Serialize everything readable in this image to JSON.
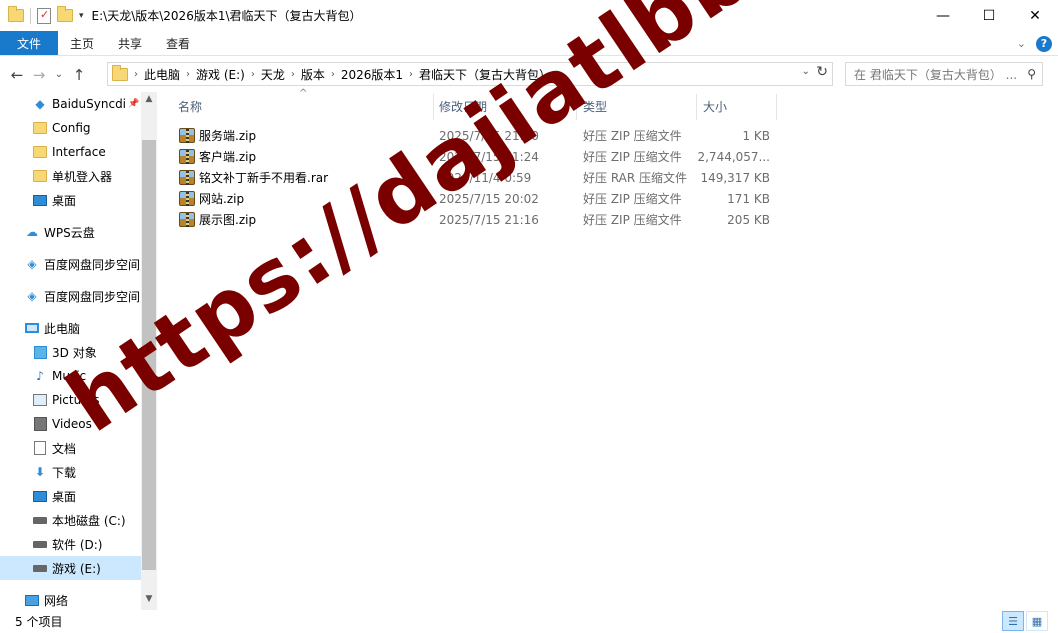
{
  "window": {
    "title": "E:\\天龙\\版本\\2026版本1\\君临天下（复古大背包）",
    "controls": {
      "minimize": "—",
      "maximize": "☐",
      "close": "✕"
    }
  },
  "ribbon": {
    "tabs": [
      "文件",
      "主页",
      "共享",
      "查看"
    ]
  },
  "nav": {
    "back": "←",
    "forward": "→",
    "recent": "⌄",
    "up": "↑",
    "breadcrumbs": [
      "此电脑",
      "游戏 (E:)",
      "天龙",
      "版本",
      "2026版本1",
      "君临天下（复古大背包）"
    ],
    "search_placeholder": "在 君临天下（复古大背包） ..."
  },
  "sidebar": {
    "items": [
      {
        "label": "BaiduSyncdi",
        "icon": "baidu-sync-icon",
        "pinned": "📌"
      },
      {
        "label": "Config",
        "icon": "folder-icon"
      },
      {
        "label": "Interface",
        "icon": "folder-icon"
      },
      {
        "label": "单机登入器",
        "icon": "folder-icon"
      },
      {
        "label": "桌面",
        "icon": "desktop-icon"
      },
      {
        "label": "WPS云盘",
        "icon": "cloud-icon"
      },
      {
        "label": "百度网盘同步空间",
        "icon": "baidu-icon"
      },
      {
        "label": "百度网盘同步空间",
        "icon": "baidu-icon"
      },
      {
        "label": "此电脑",
        "icon": "computer-icon"
      },
      {
        "label": "3D 对象",
        "icon": "3d-objects-icon"
      },
      {
        "label": "Music",
        "icon": "music-icon"
      },
      {
        "label": "Pictures",
        "icon": "pictures-icon"
      },
      {
        "label": "Videos",
        "icon": "videos-icon"
      },
      {
        "label": "文档",
        "icon": "documents-icon"
      },
      {
        "label": "下载",
        "icon": "downloads-icon"
      },
      {
        "label": "桌面",
        "icon": "desktop-icon"
      },
      {
        "label": "本地磁盘 (C:)",
        "icon": "drive-icon"
      },
      {
        "label": "软件 (D:)",
        "icon": "drive-icon"
      },
      {
        "label": "游戏 (E:)",
        "icon": "drive-icon"
      },
      {
        "label": "网络",
        "icon": "network-icon"
      }
    ]
  },
  "columns": {
    "name": "名称",
    "date": "修改日期",
    "type": "类型",
    "size": "大小"
  },
  "files": [
    {
      "name": "服务端.zip",
      "date": "2025/7/15 21:20",
      "type": "好压 ZIP 压缩文件",
      "size": "1 KB"
    },
    {
      "name": "客户端.zip",
      "date": "2025/7/15 21:24",
      "type": "好压 ZIP 压缩文件",
      "size": "2,744,057..."
    },
    {
      "name": "铭文补丁新手不用看.rar",
      "date": "2024/11/4 0:59",
      "type": "好压 RAR 压缩文件",
      "size": "149,317 KB"
    },
    {
      "name": "网站.zip",
      "date": "2025/7/15 20:02",
      "type": "好压 ZIP 压缩文件",
      "size": "171 KB"
    },
    {
      "name": "展示图.zip",
      "date": "2025/7/15 21:16",
      "type": "好压 ZIP 压缩文件",
      "size": "205 KB"
    }
  ],
  "status": {
    "count": "5 个项目"
  },
  "watermark": "https://dajiatlbb.com/"
}
